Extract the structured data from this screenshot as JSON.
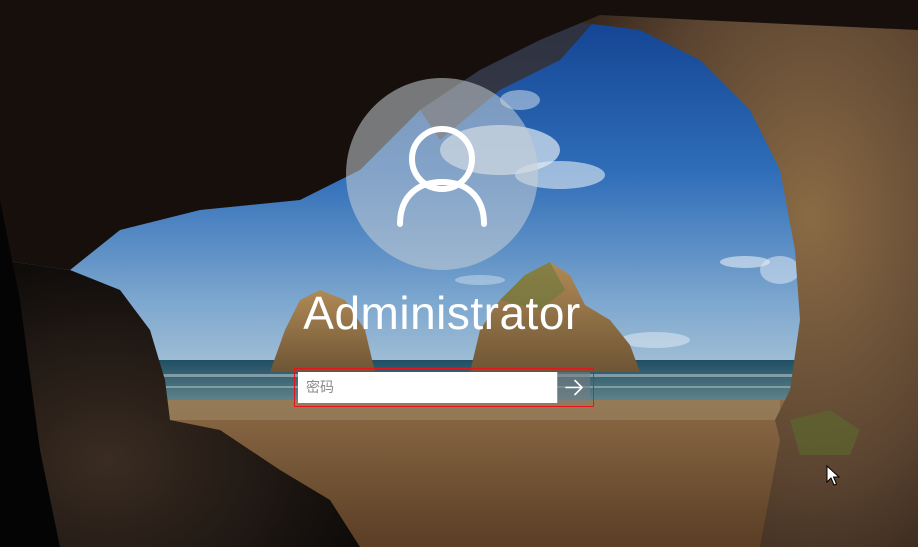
{
  "login": {
    "username": "Administrator",
    "password": {
      "value": "",
      "placeholder": "密码"
    }
  },
  "icons": {
    "avatar": "user-silhouette-icon",
    "submit": "arrow-right-icon",
    "cursor": "mouse-pointer-icon"
  },
  "colors": {
    "focus_border": "#e2161d",
    "text": "#ffffff"
  }
}
